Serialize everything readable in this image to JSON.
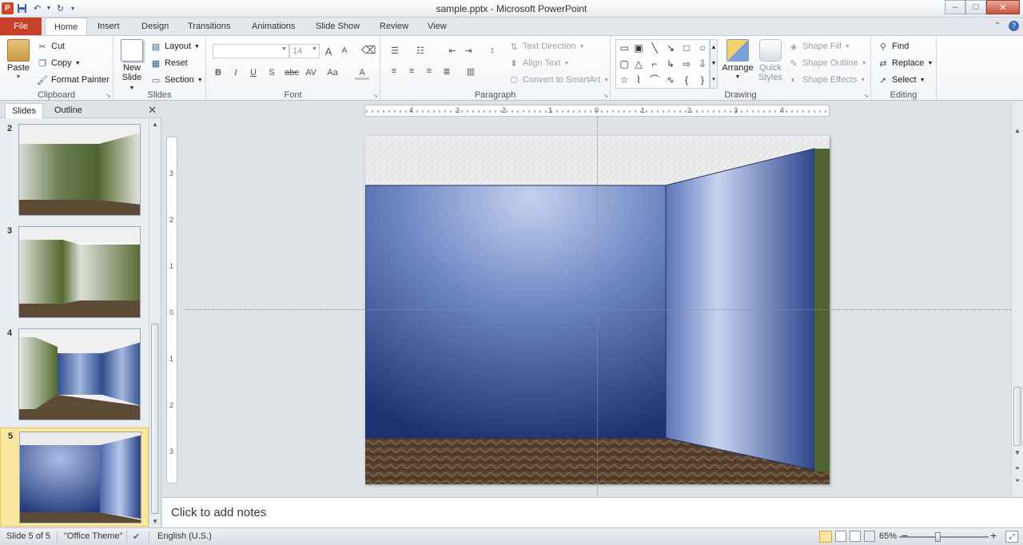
{
  "window": {
    "title": "sample.pptx - Microsoft PowerPoint",
    "controls": {
      "minimize": "–",
      "maximize": "□",
      "close": "✕"
    }
  },
  "qat": {
    "logo": "P",
    "save_icon": "save-icon",
    "undo_icon": "undo-icon",
    "redo_icon": "redo-icon"
  },
  "tabs": {
    "file": "File",
    "items": [
      "Home",
      "Insert",
      "Design",
      "Transitions",
      "Animations",
      "Slide Show",
      "Review",
      "View"
    ],
    "active": "Home"
  },
  "ribbon": {
    "clipboard": {
      "label": "Clipboard",
      "paste": "Paste",
      "cut": "Cut",
      "copy": "Copy",
      "format_painter": "Format Painter"
    },
    "slides": {
      "label": "Slides",
      "new_slide_line1": "New",
      "new_slide_line2": "Slide",
      "layout": "Layout",
      "reset": "Reset",
      "section": "Section"
    },
    "font": {
      "label": "Font",
      "font_name": "",
      "font_size": "14",
      "bold": "B",
      "italic": "I",
      "underline": "U",
      "shadow": "S",
      "strike": "abc",
      "spacing": "AV",
      "case": "Aa",
      "color": "A",
      "grow": "A",
      "shrink": "A"
    },
    "paragraph": {
      "label": "Paragraph",
      "text_direction": "Text Direction",
      "align_text": "Align Text",
      "convert_smartart": "Convert to SmartArt"
    },
    "drawing": {
      "label": "Drawing",
      "arrange": "Arrange",
      "quick_styles_line1": "Quick",
      "quick_styles_line2": "Styles",
      "shape_fill": "Shape Fill",
      "shape_outline": "Shape Outline",
      "shape_effects": "Shape Effects"
    },
    "editing": {
      "label": "Editing",
      "find": "Find",
      "replace": "Replace",
      "select": "Select"
    }
  },
  "left_pane": {
    "tab_slides": "Slides",
    "tab_outline": "Outline",
    "close": "✕",
    "thumbnails": [
      {
        "number": "2"
      },
      {
        "number": "3"
      },
      {
        "number": "4"
      },
      {
        "number": "5",
        "selected": true
      }
    ]
  },
  "rulers": {
    "horizontal": [
      "4",
      "3",
      "2",
      "1",
      "0",
      "1",
      "2",
      "3",
      "4"
    ],
    "vertical": [
      "3",
      "2",
      "1",
      "0",
      "1",
      "2",
      "3"
    ]
  },
  "notes": {
    "placeholder": "Click to add notes"
  },
  "status": {
    "slide": "Slide 5 of 5",
    "theme": "\"Office Theme\"",
    "language": "English (U.S.)",
    "zoom": "65%",
    "zoom_minus": "−",
    "zoom_plus": "+"
  }
}
